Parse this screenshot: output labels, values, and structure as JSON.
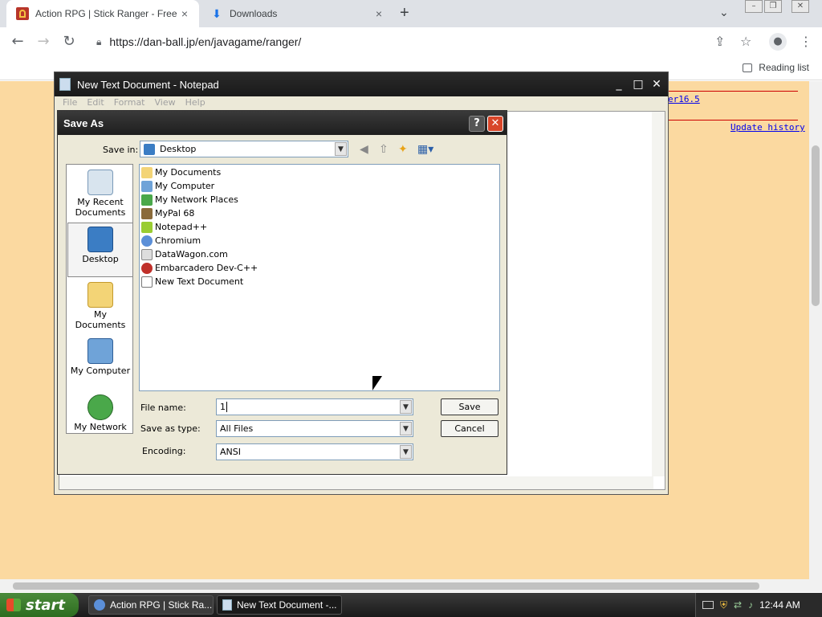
{
  "browser": {
    "tabs": [
      {
        "title": "Action RPG | Stick Ranger - Free ga",
        "close": "×"
      },
      {
        "title": "Downloads",
        "close": "×"
      }
    ],
    "new_tab": "+",
    "url": "https://dan-ball.jp/en/javagame/ranger/",
    "reading_list": "Reading list"
  },
  "page": {
    "link_version": "er16.5",
    "link_update_history": "Update history"
  },
  "notepad": {
    "title": "New Text Document - Notepad",
    "menu": [
      "File",
      "Edit",
      "Format",
      "View",
      "Help"
    ]
  },
  "save_as": {
    "title": "Save As",
    "help": "?",
    "close": "✕",
    "save_in_label": "Save in:",
    "save_in_value": "Desktop",
    "places": [
      {
        "label": "My Recent Documents"
      },
      {
        "label": "Desktop"
      },
      {
        "label": "My Documents"
      },
      {
        "label": "My Computer"
      },
      {
        "label": "My Network"
      }
    ],
    "files": [
      "My Documents",
      "My Computer",
      "My Network Places",
      "MyPal 68",
      "Notepad++",
      "Chromium",
      "DataWagon.com",
      "Embarcadero Dev-C++",
      "New Text Document"
    ],
    "file_name_label": "File name:",
    "file_name_value": "1",
    "save_as_type_label": "Save as type:",
    "save_as_type_value": "All Files",
    "encoding_label": "Encoding:",
    "encoding_value": "ANSI",
    "save_button": "Save",
    "cancel_button": "Cancel"
  },
  "taskbar": {
    "start": "start",
    "tasks": [
      "Action RPG | Stick Ra...",
      "New Text Document -..."
    ],
    "clock": "12:44 AM"
  }
}
